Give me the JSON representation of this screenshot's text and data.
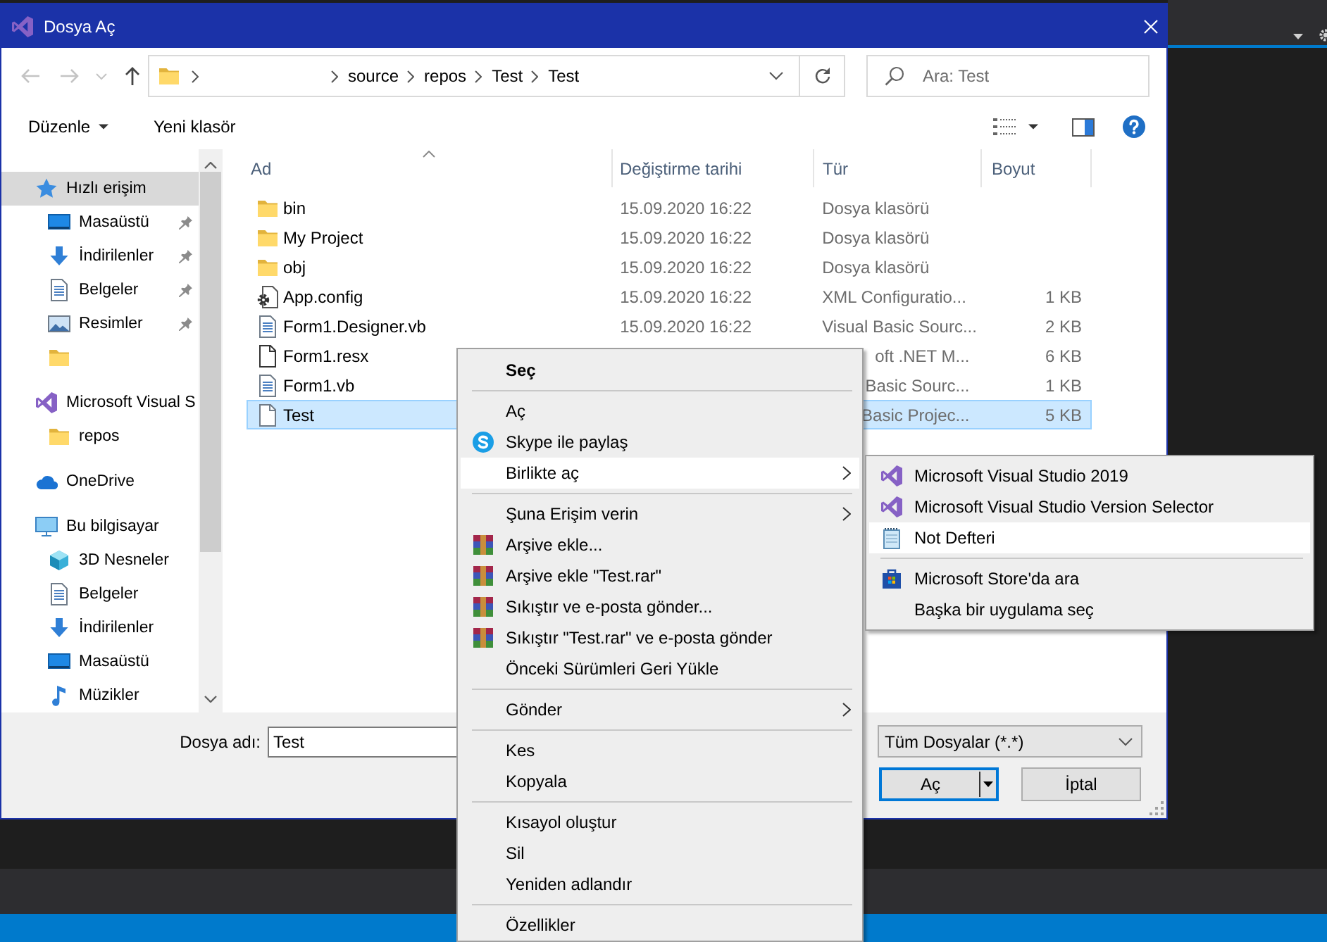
{
  "window": {
    "title": "Dosya Aç"
  },
  "navigation": {
    "buttons": [
      {
        "kind": "back",
        "disabled": true
      },
      {
        "kind": "forward",
        "disabled": true
      },
      {
        "kind": "recent",
        "disabled": true
      },
      {
        "kind": "up",
        "disabled": false
      }
    ],
    "path": [
      "source",
      "repos",
      "Test",
      "Test"
    ],
    "search": {
      "placeholder": "Ara: Test"
    }
  },
  "toolbar": {
    "buttons": [
      {
        "label": "Düzenle",
        "dropdown": true
      },
      {
        "label": "Yeni klasör",
        "dropdown": false
      }
    ]
  },
  "sidebar": {
    "items": [
      {
        "kind": "quickaccess",
        "label": "Hızlı erişim",
        "selected": true,
        "pinned": false,
        "children": [
          {
            "kind": "desktop",
            "label": "Masaüstü",
            "selected": false,
            "pinned": true
          },
          {
            "kind": "downloads",
            "label": "İndirilenler",
            "selected": false,
            "pinned": true
          },
          {
            "kind": "documents",
            "label": "Belgeler",
            "selected": false,
            "pinned": true
          },
          {
            "kind": "pictures",
            "label": "Resimler",
            "selected": false,
            "pinned": true
          },
          {
            "kind": "folder",
            "selected": false,
            "pinned": false
          }
        ]
      },
      {
        "kind": "app",
        "label": "Microsoft Visual S",
        "selected": false,
        "pinned": false,
        "children": [
          {
            "kind": "folder",
            "label": "repos",
            "selected": false,
            "pinned": false
          }
        ]
      },
      {
        "kind": "cloud",
        "label": "OneDrive",
        "selected": false,
        "pinned": false
      },
      {
        "kind": "computer",
        "label": "Bu bilgisayar",
        "selected": false,
        "pinned": false,
        "children": [
          {
            "kind": "objects",
            "label": "3D Nesneler",
            "selected": false,
            "pinned": false
          },
          {
            "kind": "documents",
            "label": "Belgeler",
            "selected": false,
            "pinned": false
          },
          {
            "kind": "downloads",
            "label": "İndirilenler",
            "selected": false,
            "pinned": false
          },
          {
            "kind": "desktop",
            "label": "Masaüstü",
            "selected": false,
            "pinned": false
          },
          {
            "kind": "music",
            "label": "Müzikler",
            "selected": false,
            "pinned": false
          }
        ]
      }
    ]
  },
  "file_list": {
    "columns": [
      {
        "label": "Ad",
        "sorted": true
      },
      {
        "label": "Değiştirme tarihi",
        "sorted": false
      },
      {
        "label": "Tür",
        "sorted": false
      },
      {
        "label": "Boyut",
        "sorted": false
      }
    ],
    "rows": [
      {
        "kind": "folder",
        "name": "bin",
        "date": "15.09.2020 16:22",
        "type": "Dosya klasörü",
        "selected": false
      },
      {
        "kind": "folder",
        "name": "My Project",
        "date": "15.09.2020 16:22",
        "type": "Dosya klasörü",
        "selected": false
      },
      {
        "kind": "folder",
        "name": "obj",
        "date": "15.09.2020 16:22",
        "type": "Dosya klasörü",
        "selected": false
      },
      {
        "kind": "config",
        "name": "App.config",
        "date": "15.09.2020 16:22",
        "type": "XML Configuratio...",
        "size": "1 KB",
        "selected": false
      },
      {
        "kind": "code",
        "name": "Form1.Designer.vb",
        "date": "15.09.2020 16:22",
        "type": "Visual Basic Sourc...",
        "size": "2 KB",
        "selected": false
      },
      {
        "kind": "resource",
        "name": "Form1.resx",
        "type": "oft .NET M...",
        "size": "6 KB",
        "selected": false
      },
      {
        "kind": "code",
        "name": "Form1.vb",
        "type": "Basic Sourc...",
        "size": "1 KB",
        "selected": false
      },
      {
        "kind": "file",
        "name": "Test",
        "type": "Basic Projec...",
        "size": "5 KB",
        "selected": true
      }
    ]
  },
  "file_name": {
    "label": "Dosya adı:",
    "value": "Test"
  },
  "file_type": {
    "value": "Tüm Dosyalar (*.*)"
  },
  "buttons": [
    {
      "label": "Aç",
      "kind": "split",
      "default": true
    },
    {
      "label": "İptal",
      "kind": "plain",
      "default": false
    }
  ],
  "context_menu": {
    "groups": [
      [
        {
          "label": "Seç",
          "kind": "plain",
          "default": true,
          "highlighted": false,
          "submenu": false
        }
      ],
      [
        {
          "label": "Aç",
          "kind": "plain",
          "default": false,
          "highlighted": false,
          "submenu": false
        },
        {
          "label": "Skype ile paylaş",
          "kind": "skype",
          "default": false,
          "highlighted": false,
          "submenu": false
        },
        {
          "label": "Birlikte aç",
          "kind": "plain",
          "default": false,
          "highlighted": true,
          "submenu": true
        }
      ],
      [
        {
          "label": "Şuna Erişim verin",
          "kind": "plain",
          "default": false,
          "highlighted": false,
          "submenu": true
        },
        {
          "label": "Arşive ekle...",
          "kind": "archive",
          "default": false,
          "highlighted": false,
          "submenu": false
        },
        {
          "label": "Arşive ekle \"Test.rar\"",
          "kind": "archive",
          "default": false,
          "highlighted": false,
          "submenu": false
        },
        {
          "label": "Sıkıştır ve e-posta gönder...",
          "kind": "archive",
          "default": false,
          "highlighted": false,
          "submenu": false
        },
        {
          "label": "Sıkıştır \"Test.rar\" ve e-posta gönder",
          "kind": "archive",
          "default": false,
          "highlighted": false,
          "submenu": false
        },
        {
          "label": "Önceki Sürümleri Geri Yükle",
          "kind": "plain",
          "default": false,
          "highlighted": false,
          "submenu": false
        }
      ],
      [
        {
          "label": "Gönder",
          "kind": "plain",
          "default": false,
          "highlighted": false,
          "submenu": true
        }
      ],
      [
        {
          "label": "Kes",
          "kind": "plain",
          "default": false,
          "highlighted": false,
          "submenu": false
        },
        {
          "label": "Kopyala",
          "kind": "plain",
          "default": false,
          "highlighted": false,
          "submenu": false
        }
      ],
      [
        {
          "label": "Kısayol oluştur",
          "kind": "plain",
          "default": false,
          "highlighted": false,
          "submenu": false
        },
        {
          "label": "Sil",
          "kind": "plain",
          "default": false,
          "highlighted": false,
          "submenu": false
        },
        {
          "label": "Yeniden adlandır",
          "kind": "plain",
          "default": false,
          "highlighted": false,
          "submenu": false
        }
      ],
      [
        {
          "label": "Özellikler",
          "kind": "plain",
          "default": false,
          "highlighted": false,
          "submenu": false
        }
      ]
    ]
  },
  "submenu": {
    "groups": [
      [
        {
          "label": "Microsoft Visual Studio 2019",
          "kind": "app",
          "highlighted": false
        },
        {
          "label": "Microsoft Visual Studio Version Selector",
          "kind": "app",
          "highlighted": false
        },
        {
          "label": "Not Defteri",
          "kind": "notepad",
          "highlighted": true
        }
      ],
      [
        {
          "label": "Microsoft Store'da ara",
          "kind": "store",
          "highlighted": false
        },
        {
          "label": "Başka bir uygulama seç",
          "kind": "plain",
          "highlighted": false
        }
      ]
    ]
  }
}
